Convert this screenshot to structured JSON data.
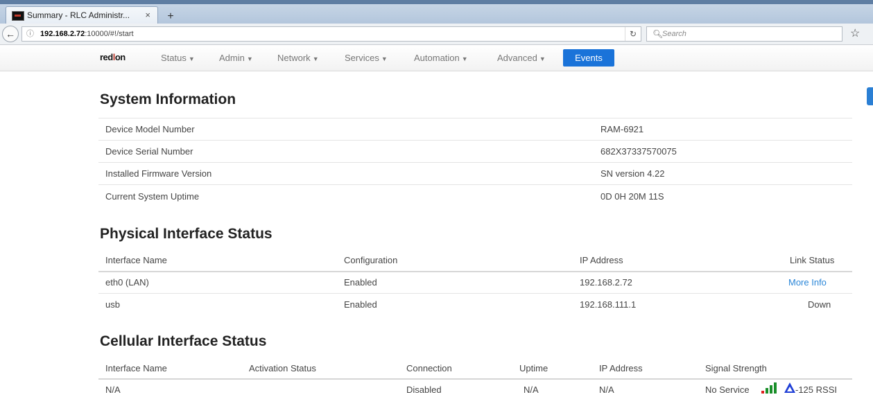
{
  "browser": {
    "tab_title": "Summary - RLC Administr...",
    "tab_close": "×",
    "new_tab": "+",
    "url_host": "192.168.2.72",
    "url_rest": ":10000/#!/start",
    "search_placeholder": "Search"
  },
  "nav": {
    "brand_a": "red",
    "brand_b": "l",
    "brand_c": "on",
    "items": [
      "Status",
      "Admin",
      "Network",
      "Services",
      "Automation",
      "Advanced"
    ],
    "events": "Events"
  },
  "system_info": {
    "title": "System Information",
    "rows": [
      {
        "label": "Device Model Number",
        "value": "RAM-6921"
      },
      {
        "label": "Device Serial Number",
        "value": "682X37337570075"
      },
      {
        "label": "Installed Firmware Version",
        "value": "SN version 4.22"
      },
      {
        "label": "Current System Uptime",
        "value": "0D 0H 20M 11S"
      }
    ]
  },
  "physical": {
    "title": "Physical Interface Status",
    "headers": [
      "Interface Name",
      "Configuration",
      "IP Address",
      "Link Status"
    ],
    "rows": [
      {
        "name": "eth0 (LAN)",
        "config": "Enabled",
        "ip": "192.168.2.72",
        "link": "More Info"
      },
      {
        "name": "usb",
        "config": "Enabled",
        "ip": "192.168.111.1",
        "link": "Down"
      }
    ]
  },
  "cellular": {
    "title": "Cellular Interface Status",
    "headers": [
      "Interface Name",
      "Activation Status",
      "Connection",
      "Uptime",
      "IP Address",
      "Signal Strength"
    ],
    "row": {
      "name": "N/A",
      "activation": "",
      "connection": "Disabled",
      "uptime": "N/A",
      "ip": "N/A",
      "signal_text": "No Service",
      "rssi": "-125 RSSI"
    },
    "signal_colors": [
      "#e02020",
      "#1a8f2a",
      "#1a8f2a",
      "#1a8f2a"
    ]
  }
}
